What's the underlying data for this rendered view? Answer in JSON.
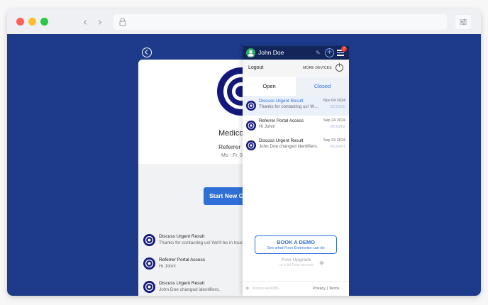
{
  "browser": {
    "nav_back": "‹",
    "nav_forward": "›"
  },
  "page": {
    "clinic_name": "Medico",
    "referrer": "Referrer C",
    "hours": "Mo - Fr, 9",
    "start_button": "Start New Ch",
    "conversations": [
      {
        "title": "Discuss Urgent Result",
        "subtitle": "Thanks for contacting us! We'll be in touch"
      },
      {
        "title": "Referrer Portal Access",
        "subtitle": "Hi John!"
      },
      {
        "title": "Discuss Urgent Result",
        "subtitle": "John Doe changed identifiers."
      }
    ]
  },
  "panel": {
    "user_name": "John Doe",
    "notification_count": "7",
    "icons": {
      "edit": "pen-icon",
      "add": "plus-icon",
      "menu": "menu-icon",
      "logout": "power-icon"
    },
    "logout_label": "Logout",
    "more_devices_label": "MORE DEVICES",
    "tabs": {
      "open": "Open",
      "closed": "Closed"
    },
    "items": [
      {
        "title": "Discuss Urgent Result",
        "subtitle": "Thanks for contacting us! We'll be in touch",
        "date": "Nov 04 2024",
        "code": "BCG000"
      },
      {
        "title": "Referrer Portal Access",
        "subtitle": "Hi John!",
        "date": "Sep 24 2024",
        "code": "BCG002"
      },
      {
        "title": "Discuss Urgent Result",
        "subtitle": "John Doe changed identifiers.",
        "date": "Sep 24 2024",
        "code": "BCG001"
      }
    ],
    "demo": {
      "title": "BOOK A DEMO",
      "subtitle": "See what Foxo Enterprise can do"
    },
    "upgrade": {
      "title": "Free Upgrade",
      "subtitle": "to a full Foxo account"
    },
    "version": "Version 4e04380",
    "privacy": "Privacy",
    "separator": "|",
    "terms": "Terms"
  },
  "colors": {
    "background": "#1d3b8a",
    "panel_header": "#13265a",
    "accent": "#2f6fd6",
    "badge": "#e53935"
  }
}
